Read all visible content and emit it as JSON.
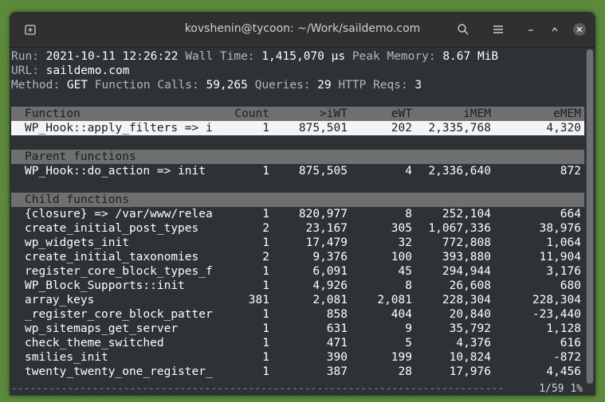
{
  "window": {
    "title": "kovshenin@tycoon: ~/Work/saildemo.com"
  },
  "summary": {
    "run_label": "Run:",
    "run": "2021-10-11 12:26:22",
    "walltime_label": "Wall Time:",
    "walltime": "1,415,070 µs",
    "peakmem_label": "Peak Memory:",
    "peakmem": "8.67 MiB",
    "url_label": "URL:",
    "url": "saildemo.com",
    "method_label": "Method:",
    "method": "GET",
    "calls_label": "Function Calls:",
    "calls": "59,265",
    "queries_label": "Queries:",
    "queries": "29",
    "http_label": "HTTP Reqs:",
    "http": "3"
  },
  "columns": {
    "name": "Function",
    "count": "Count",
    "iwt": ">iWT",
    "ewt": "eWT",
    "imem": "iMEM",
    "emem": "eMEM"
  },
  "selected": {
    "name": "WP_Hook::apply_filters => i",
    "count": "1",
    "iwt": "875,501",
    "ewt": "202",
    "imem": "2,335,768",
    "emem": "4,320"
  },
  "parent_title": "Parent functions",
  "parents": [
    {
      "name": "WP_Hook::do_action => init",
      "count": "1",
      "iwt": "875,505",
      "ewt": "4",
      "imem": "2,336,640",
      "emem": "872"
    }
  ],
  "child_title": "Child functions",
  "children": [
    {
      "name": "{closure} => /var/www/relea",
      "count": "1",
      "iwt": "820,977",
      "ewt": "8",
      "imem": "252,104",
      "emem": "664"
    },
    {
      "name": "create_initial_post_types",
      "count": "2",
      "iwt": "23,167",
      "ewt": "305",
      "imem": "1,067,336",
      "emem": "38,976"
    },
    {
      "name": "wp_widgets_init",
      "count": "1",
      "iwt": "17,479",
      "ewt": "32",
      "imem": "772,808",
      "emem": "1,064"
    },
    {
      "name": "create_initial_taxonomies",
      "count": "2",
      "iwt": "9,376",
      "ewt": "100",
      "imem": "393,880",
      "emem": "11,904"
    },
    {
      "name": "register_core_block_types_f",
      "count": "1",
      "iwt": "6,091",
      "ewt": "45",
      "imem": "294,944",
      "emem": "3,176"
    },
    {
      "name": "WP_Block_Supports::init",
      "count": "1",
      "iwt": "4,926",
      "ewt": "8",
      "imem": "26,608",
      "emem": "680"
    },
    {
      "name": "array_keys",
      "count": "381",
      "iwt": "2,081",
      "ewt": "2,081",
      "imem": "228,304",
      "emem": "228,304"
    },
    {
      "name": "_register_core_block_patter",
      "count": "1",
      "iwt": "858",
      "ewt": "404",
      "imem": "20,840",
      "emem": "-23,440"
    },
    {
      "name": "wp_sitemaps_get_server",
      "count": "1",
      "iwt": "631",
      "ewt": "9",
      "imem": "35,792",
      "emem": "1,128"
    },
    {
      "name": "check_theme_switched",
      "count": "1",
      "iwt": "471",
      "ewt": "5",
      "imem": "4,376",
      "emem": "616"
    },
    {
      "name": "smilies_init",
      "count": "1",
      "iwt": "390",
      "ewt": "199",
      "imem": "10,824",
      "emem": "-872"
    },
    {
      "name": "twenty_twenty_one_register_",
      "count": "1",
      "iwt": "387",
      "ewt": "28",
      "imem": "17,976",
      "emem": "4,456"
    }
  ],
  "status": {
    "position": "1/59 1%"
  }
}
